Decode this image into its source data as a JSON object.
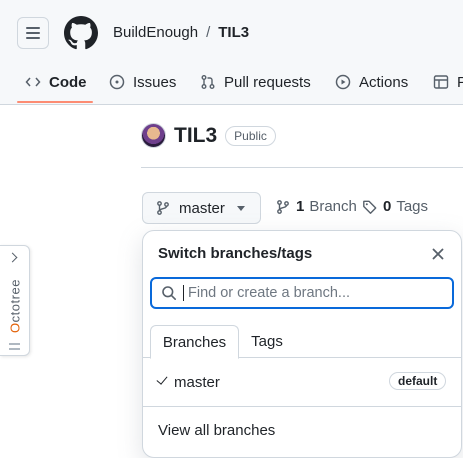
{
  "header": {
    "owner": "BuildEnough",
    "separator": "/",
    "repo": "TIL3"
  },
  "tabs": [
    {
      "label": "Code",
      "icon": "code-icon"
    },
    {
      "label": "Issues",
      "icon": "issue-icon"
    },
    {
      "label": "Pull requests",
      "icon": "pull-request-icon"
    },
    {
      "label": "Actions",
      "icon": "play-icon"
    },
    {
      "label": "P",
      "icon": "table-icon"
    }
  ],
  "repo": {
    "name": "TIL3",
    "visibility": "Public"
  },
  "branch_button": {
    "label": "master"
  },
  "stats": {
    "branch_count": "1",
    "branch_label": "Branch",
    "tag_count": "0",
    "tag_label": "Tags"
  },
  "octotree": {
    "first_letter": "O",
    "rest": "ctotree"
  },
  "dropdown": {
    "title": "Switch branches/tags",
    "search_placeholder": "Find or create a branch...",
    "tabs": [
      "Branches",
      "Tags"
    ],
    "branches": [
      {
        "name": "master",
        "badge": "default",
        "selected": true
      }
    ],
    "view_all": "View all branches"
  },
  "colors": {
    "accent": "#0969da",
    "tab_underline": "#fd8c73",
    "octotree_accent": "#e36209"
  }
}
